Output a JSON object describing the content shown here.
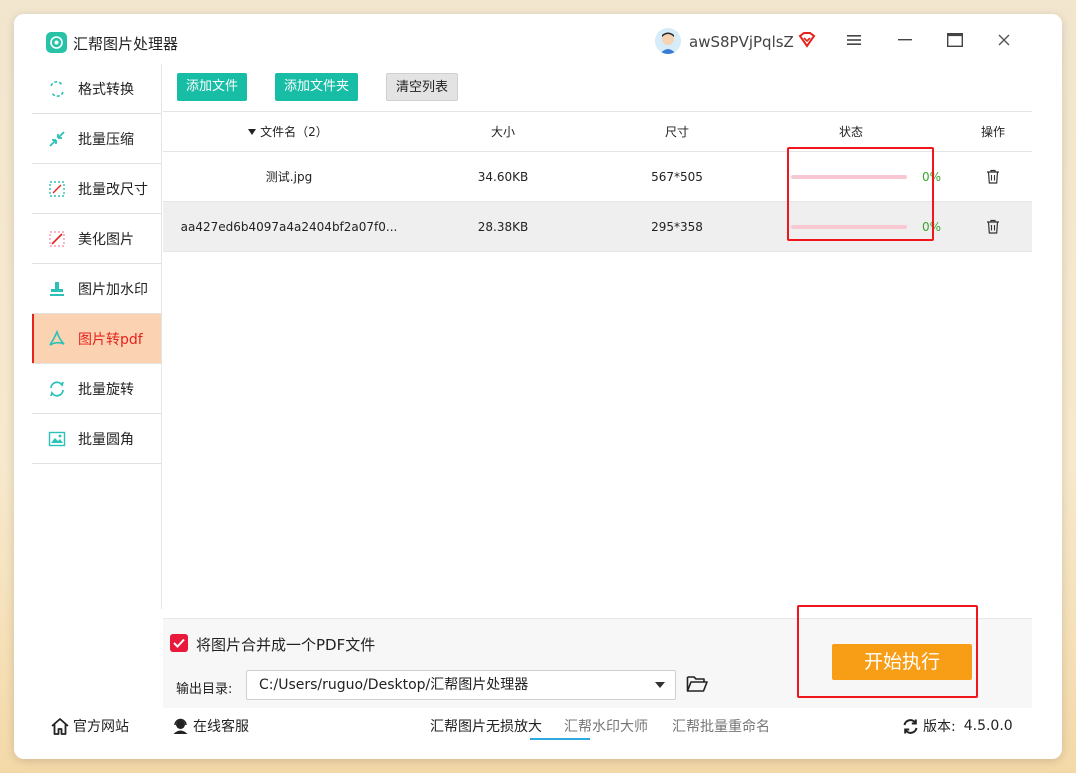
{
  "app": {
    "title": "汇帮图片处理器"
  },
  "user": {
    "name": "awS8PVjPqlsZ"
  },
  "sidebar": {
    "items": [
      {
        "label": "格式转换",
        "icon": "format-convert-icon",
        "active": false
      },
      {
        "label": "批量压缩",
        "icon": "compress-icon",
        "active": false
      },
      {
        "label": "批量改尺寸",
        "icon": "resize-icon",
        "active": false
      },
      {
        "label": "美化图片",
        "icon": "beautify-icon",
        "active": false
      },
      {
        "label": "图片加水印",
        "icon": "watermark-icon",
        "active": false
      },
      {
        "label": "图片转pdf",
        "icon": "pdf-icon",
        "active": true
      },
      {
        "label": "批量旋转",
        "icon": "rotate-icon",
        "active": false
      },
      {
        "label": "批量圆角",
        "icon": "round-corner-icon",
        "active": false
      }
    ]
  },
  "toolbar": {
    "add_file": "添加文件",
    "add_folder": "添加文件夹",
    "clear_list": "清空列表"
  },
  "table": {
    "headers": {
      "name": "文件名（2）",
      "size": "大小",
      "dimensions": "尺寸",
      "status": "状态",
      "actions": "操作"
    },
    "rows": [
      {
        "name": "测试.jpg",
        "size": "34.60KB",
        "dimensions": "567*505",
        "progress_text": "0%",
        "progress": 0
      },
      {
        "name": "aa427ed6b4097a4a2404bf2a07f0...",
        "size": "28.38KB",
        "dimensions": "295*358",
        "progress_text": "0%",
        "progress": 0
      }
    ]
  },
  "options": {
    "merge_label": "将图片合并成一个PDF文件",
    "merge_checked": true,
    "output_label": "输出目录:",
    "output_path": "C:/Users/ruguo/Desktop/汇帮图片处理器"
  },
  "start_button": "开始执行",
  "footer": {
    "website": "官方网站",
    "support": "在线客服",
    "tabs": [
      "汇帮图片无损放大",
      "汇帮水印大师",
      "汇帮批量重命名"
    ],
    "version_label": "版本:",
    "version": "4.5.0.0"
  },
  "colors": {
    "accent_teal": "#18bda6",
    "active_red": "#e5221c",
    "start_orange": "#f89e16",
    "highlight_red": "#f0161c"
  }
}
